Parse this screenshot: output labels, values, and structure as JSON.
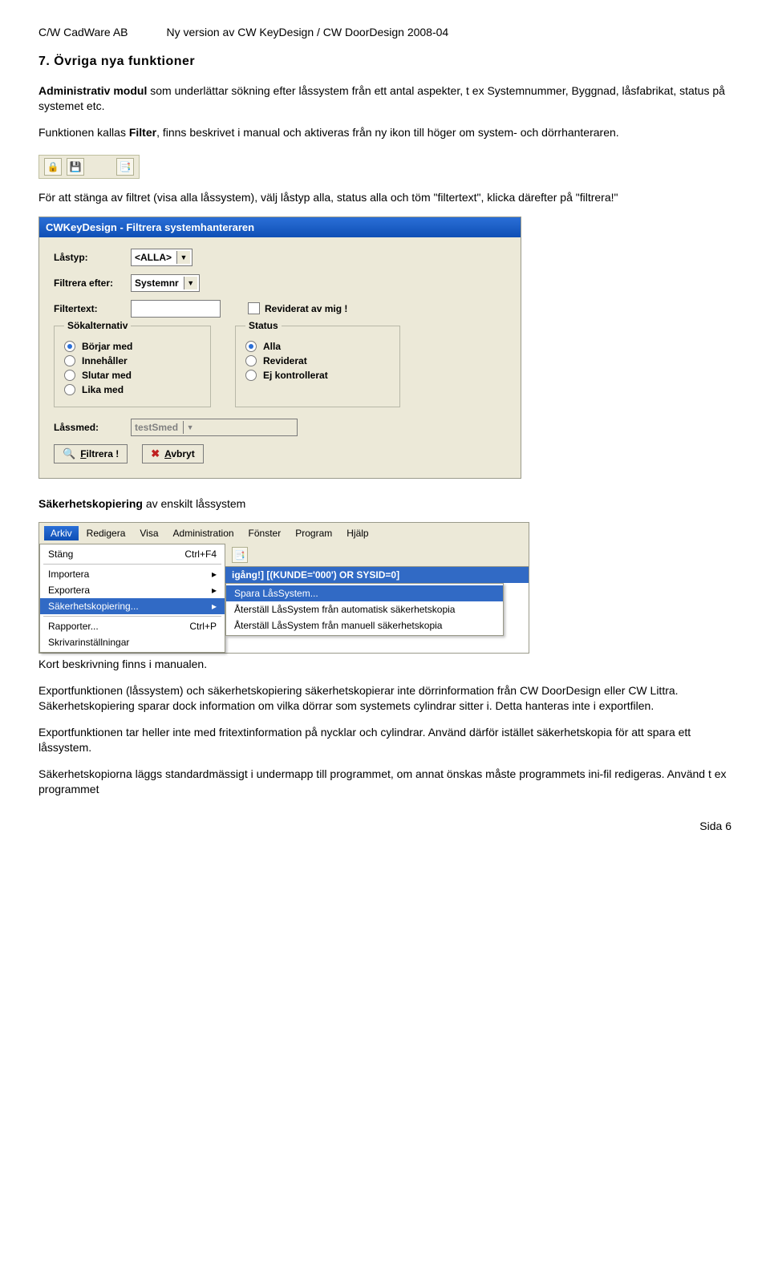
{
  "header": {
    "left": "C/W CadWare AB",
    "right": "Ny version av CW KeyDesign / CW DoorDesign 2008-04"
  },
  "section_title": "7. Övriga nya funktioner",
  "para1_a": "Administrativ modul",
  "para1_b": " som underlättar sökning efter låssystem från ett antal aspekter, t ex Systemnummer, Byggnad, låsfabrikat, status på systemet etc.",
  "para2_a": "Funktionen kallas ",
  "para2_b": "Filter",
  "para2_c": ", finns beskrivet i manual och aktiveras från ny ikon till höger om system- och dörrhanteraren.",
  "toolbar_icons": {
    "a": "🔒",
    "b": "💾",
    "c": "📑"
  },
  "para3": "För att stänga av filtret (visa alla låssystem), välj låstyp alla, status alla och töm \"filtertext\", klicka därefter på \"filtrera!\"",
  "dialog": {
    "title": "CWKeyDesign - Filtrera systemhanteraren",
    "lastyp_label": "Låstyp:",
    "lastyp_value": "<ALLA>",
    "filtrera_efter_label": "Filtrera efter:",
    "filtrera_efter_value": "Systemnr",
    "filtertext_label": "Filtertext:",
    "reviderat_checkbox": "Reviderat av mig !",
    "group1_title": "Sökalternativ",
    "group1_opts": [
      "Börjar med",
      "Innehåller",
      "Slutar med",
      "Lika med"
    ],
    "group2_title": "Status",
    "group2_opts": [
      "Alla",
      "Reviderat",
      "Ej kontrollerat"
    ],
    "lassmed_label": "Låssmed:",
    "lassmed_value": "testSmed",
    "btn_filter_icon": "🔍",
    "btn_filter_text": "Filtrera !",
    "btn_filter_u": "F",
    "btn_cancel_icon": "✖",
    "btn_cancel_text": "Avbryt",
    "btn_cancel_u": "A"
  },
  "heading2_a": "Säkerhetskopiering",
  "heading2_b": " av enskilt låssystem",
  "menu": {
    "bar": [
      "Arkiv",
      "Redigera",
      "Visa",
      "Administration",
      "Fönster",
      "Program",
      "Hjälp"
    ],
    "tool_icon": "📑",
    "items": [
      {
        "label": "Stäng",
        "accel": "Ctrl+F4"
      },
      {
        "sep": true
      },
      {
        "label": "Importera",
        "sub": true
      },
      {
        "label": "Exportera",
        "sub": true
      },
      {
        "label": "Säkerhetskopiering...",
        "sub": true,
        "hover": true
      },
      {
        "sep": true
      },
      {
        "label": "Rapporter...",
        "accel": "Ctrl+P"
      },
      {
        "label": "Skrivarinställningar"
      }
    ],
    "context_bar": "igång!] [(KUNDE='000') OR SYSID=0]",
    "submenu": [
      {
        "label": "Spara LåsSystem...",
        "hover": true
      },
      {
        "label": "Återställ LåsSystem från automatisk säkerhetskopia"
      },
      {
        "label": "Återställ LåsSystem från manuell säkerhetskopia"
      }
    ]
  },
  "para4": "Kort beskrivning finns i manualen.",
  "para5": "Exportfunktionen (låssystem) och säkerhetskopiering säkerhetskopierar inte dörrinformation från CW DoorDesign eller CW Littra.",
  "para6": "Säkerhetskopiering sparar dock information om vilka dörrar som systemets cylindrar sitter i. Detta hanteras inte i exportfilen.",
  "para7": "Exportfunktionen tar heller inte med fritextinformation på nycklar och cylindrar. Använd därför istället säkerhetskopia för att spara ett låssystem.",
  "para8": "Säkerhetskopiorna läggs standardmässigt i undermapp till programmet, om annat önskas måste programmets ini-fil redigeras. Använd t ex programmet",
  "footer": "Sida 6"
}
